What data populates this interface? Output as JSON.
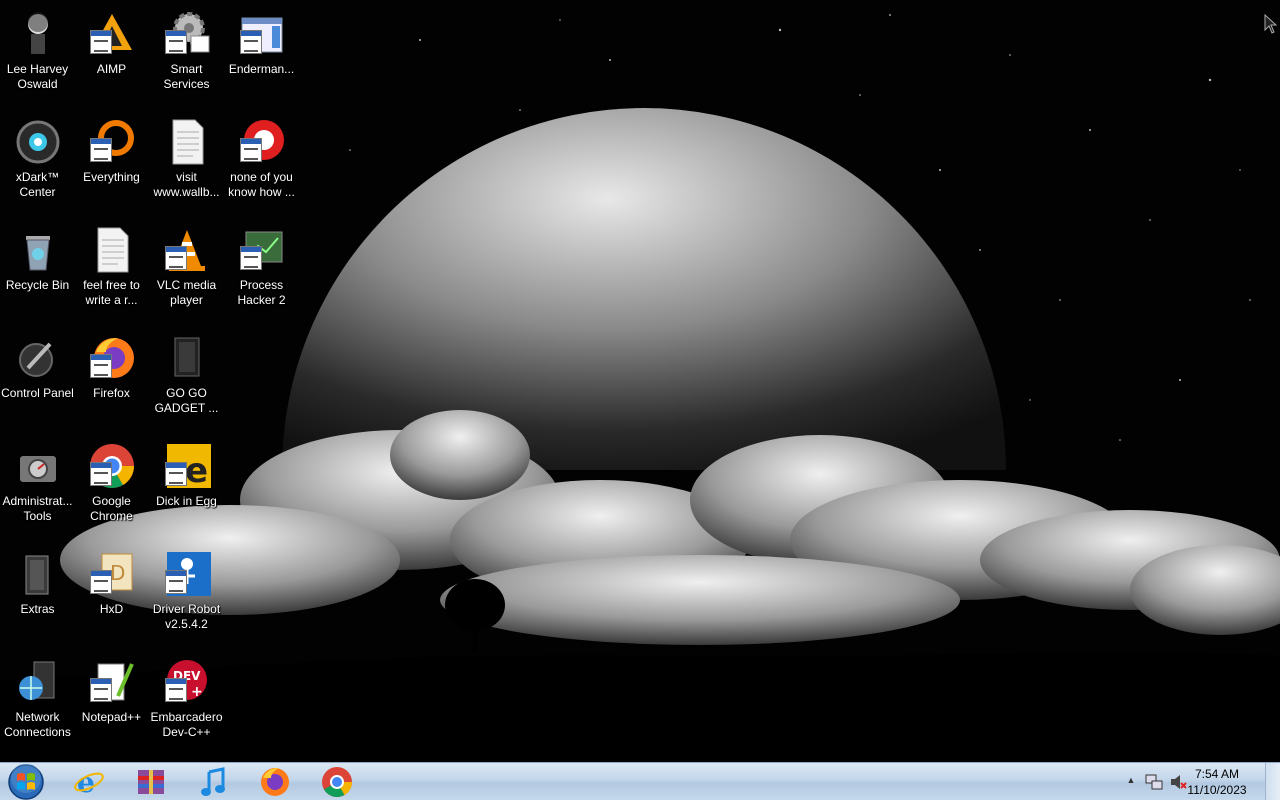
{
  "desktop": {
    "icons": [
      {
        "label": "Lee Harvey Oswald",
        "icon": "user-figure-icon"
      },
      {
        "label": "xDark™ Center",
        "icon": "xdark-orb-icon"
      },
      {
        "label": "Recycle Bin",
        "icon": "recycle-bin-icon"
      },
      {
        "label": "Control Panel",
        "icon": "control-panel-icon"
      },
      {
        "label": "Administrat... Tools",
        "icon": "admin-tools-icon"
      },
      {
        "label": "Extras",
        "icon": "folder-icon"
      },
      {
        "label": "Network Connections",
        "icon": "network-icon"
      },
      {
        "label": "AIMP",
        "icon": "aimp-icon"
      },
      {
        "label": "Everything",
        "icon": "everything-icon"
      },
      {
        "label": "feel free to write a r...",
        "icon": "text-file-icon"
      },
      {
        "label": "Firefox",
        "icon": "firefox-icon"
      },
      {
        "label": "Google Chrome",
        "icon": "chrome-icon"
      },
      {
        "label": "HxD",
        "icon": "hxd-icon"
      },
      {
        "label": "Notepad++",
        "icon": "notepadpp-icon"
      },
      {
        "label": "Smart Services",
        "icon": "gear-icon"
      },
      {
        "label": "visit www.wallb...",
        "icon": "text-file-icon"
      },
      {
        "label": "VLC media player",
        "icon": "vlc-cone-icon"
      },
      {
        "label": "GO GO GADGET ...",
        "icon": "dark-folder-icon"
      },
      {
        "label": "Dick in Egg",
        "icon": "egg-app-icon"
      },
      {
        "label": "Driver Robot v2.5.4.2",
        "icon": "driver-robot-icon"
      },
      {
        "label": "Embarcadero Dev-C++",
        "icon": "devcpp-icon"
      },
      {
        "label": "Enderman...",
        "icon": "window-app-icon"
      },
      {
        "label": "none of you know how ...",
        "icon": "red-app-icon"
      },
      {
        "label": "Process Hacker 2",
        "icon": "process-hacker-icon"
      }
    ]
  },
  "taskbar": {
    "start_label": "Start",
    "pinned": [
      {
        "name": "Internet Explorer",
        "icon": "ie-icon"
      },
      {
        "name": "Archiver",
        "icon": "archive-icon"
      },
      {
        "name": "Music",
        "icon": "music-note-icon"
      },
      {
        "name": "Firefox",
        "icon": "firefox-icon"
      },
      {
        "name": "Google Chrome",
        "icon": "chrome-icon"
      }
    ],
    "tray": {
      "time": "7:54 AM",
      "date": "11/10/2023",
      "show_hidden": "▲"
    }
  }
}
